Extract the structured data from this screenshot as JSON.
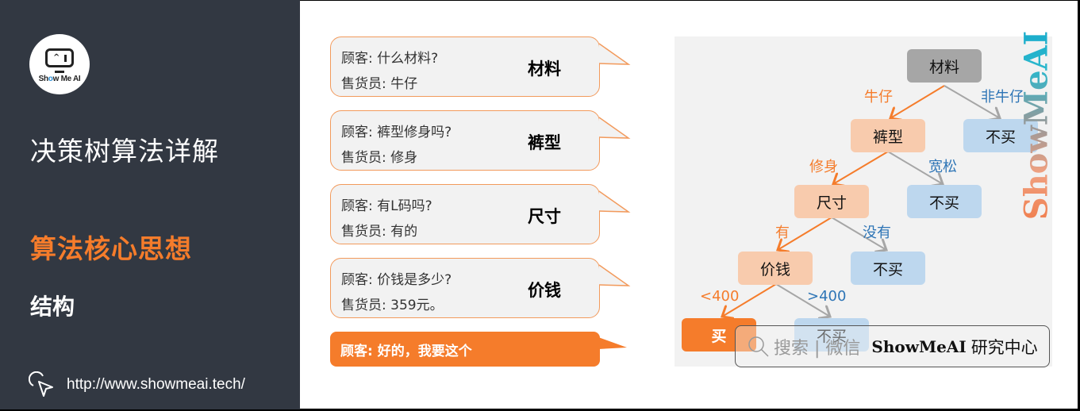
{
  "sidebar": {
    "logo_text": "Show Me AI",
    "title": "决策树算法详解",
    "section": "算法核心思想",
    "subsection": "结构",
    "url": "http://www.showmeai.tech/",
    "url_icon": "cursor-click-icon"
  },
  "dialogue": [
    {
      "question": "顾客: 什么材料?",
      "answer": "售货员: 牛仔",
      "feature": "材料"
    },
    {
      "question": "顾客: 裤型修身吗?",
      "answer": "售货员: 修身",
      "feature": "裤型"
    },
    {
      "question": "顾客: 有L码吗?",
      "answer": "售货员: 有的",
      "feature": "尺寸"
    },
    {
      "question": "顾客: 价钱是多少?",
      "answer": "售货员: 359元。",
      "feature": "价钱"
    }
  ],
  "final_statement": "顾客: 好的，我要这个",
  "tree": {
    "nodes": {
      "root": "材料",
      "n1": "裤型",
      "n1_no": "不买",
      "n2": "尺寸",
      "n2_no": "不买",
      "n3": "价钱",
      "n3_no": "不买",
      "leaf_yes": "买",
      "leaf_no": "不买"
    },
    "edges": {
      "root_yes": "牛仔",
      "root_no": "非牛仔",
      "n1_yes": "修身",
      "n1_no": "宽松",
      "n2_yes": "有",
      "n2_no": "没有",
      "n3_yes": "<400",
      "n3_no": ">400"
    },
    "colors": {
      "yes_path": "#f57c2b",
      "no_path": "#a6a6a6",
      "yes_label": "#f57c2b",
      "no_label": "#2e75b6"
    }
  },
  "watermark": "ShowMeAI",
  "search": {
    "hint": "搜索 | 微信",
    "brand": "ShowMeAI",
    "brand_suffix": "研究中心",
    "icon": "search-icon"
  }
}
